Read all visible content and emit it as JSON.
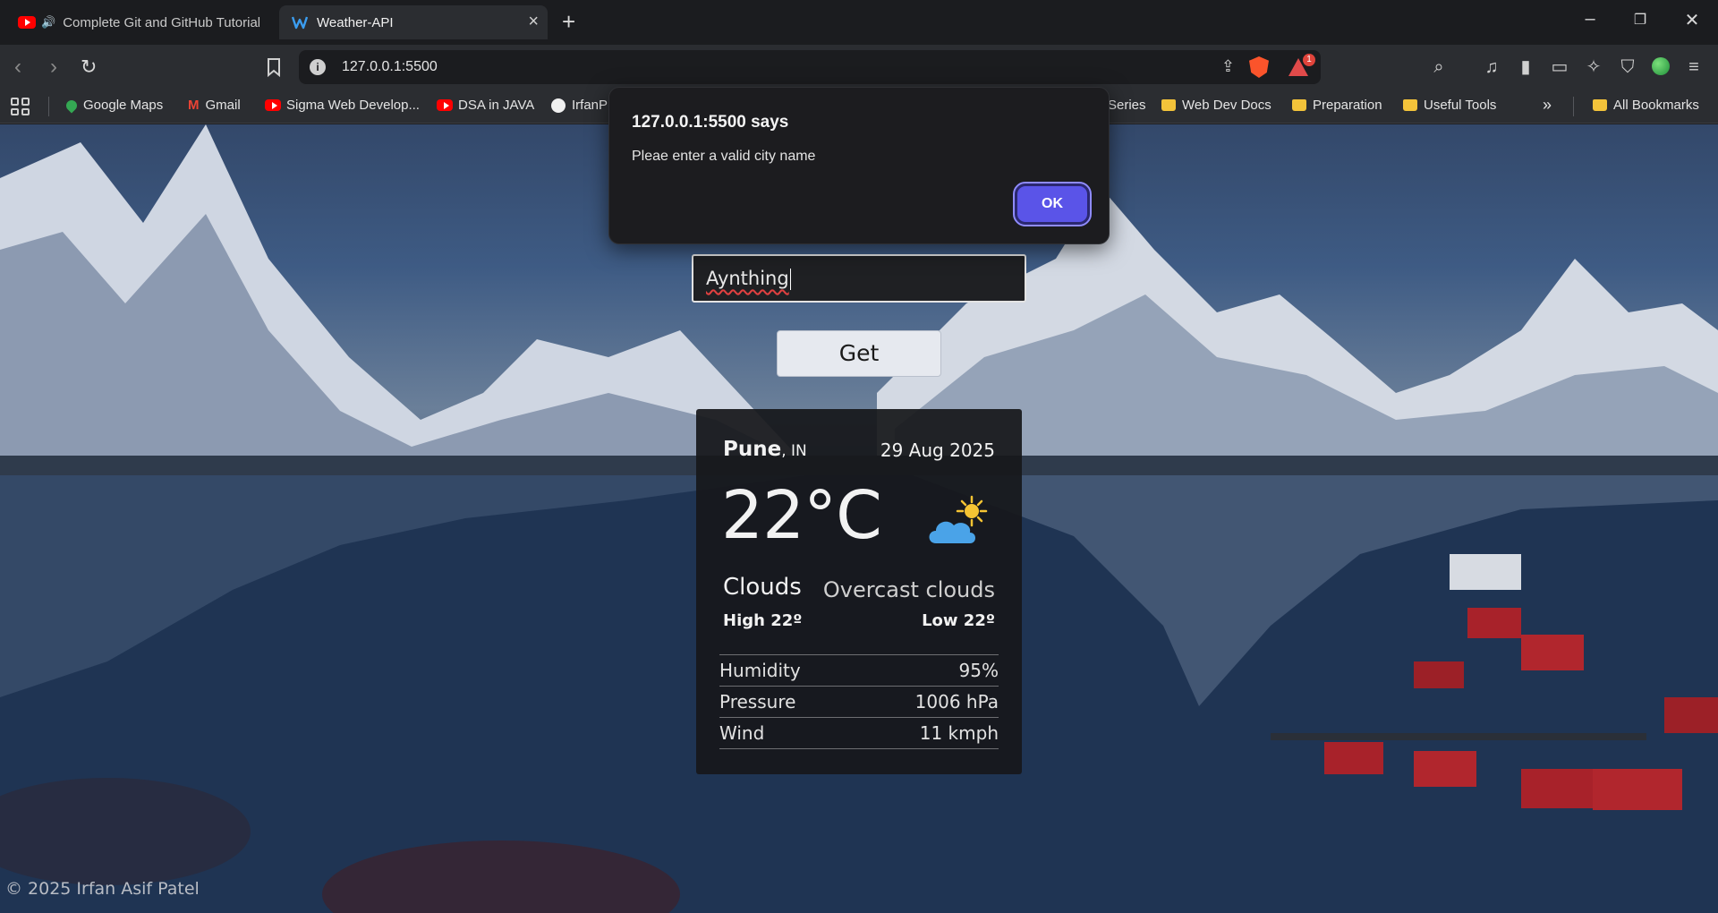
{
  "browser": {
    "tabs": [
      {
        "title": "Complete Git and GitHub Tutorial"
      },
      {
        "title": "Weather-API"
      }
    ],
    "url": "127.0.0.1:5500",
    "rewards_badge": "1",
    "bookmarks": [
      {
        "label": "Google Maps"
      },
      {
        "label": "Gmail"
      },
      {
        "label": "Sigma Web Develop..."
      },
      {
        "label": "DSA in JAVA"
      },
      {
        "label": "IrfanP"
      },
      {
        "label": "Series"
      },
      {
        "label": "Web Dev Docs"
      },
      {
        "label": "Preparation"
      },
      {
        "label": "Useful Tools"
      },
      {
        "label": "All Bookmarks"
      }
    ]
  },
  "dialog": {
    "title": "127.0.0.1:5500 says",
    "message": "Pleae enter a valid city name",
    "ok_label": "OK"
  },
  "search": {
    "value": "Aynthing",
    "button_label": "Get"
  },
  "weather": {
    "city": "Pune",
    "country": ", IN",
    "date": "29 Aug 2025",
    "temperature": "22°C",
    "condition": "Clouds",
    "description": "Overcast clouds",
    "high": "High 22º",
    "low": "Low 22º",
    "icon": "cloud-sun-icon",
    "details": [
      {
        "label": "Humidity",
        "value": "95%"
      },
      {
        "label": "Pressure",
        "value": "1006 hPa"
      },
      {
        "label": "Wind",
        "value": "11 kmph"
      }
    ]
  },
  "footer": "© 2025 Irfan Asif Patel",
  "colors": {
    "accent": "#5a54e8",
    "card_bg": "#17181b",
    "chrome_bg": "#2b2d31"
  }
}
